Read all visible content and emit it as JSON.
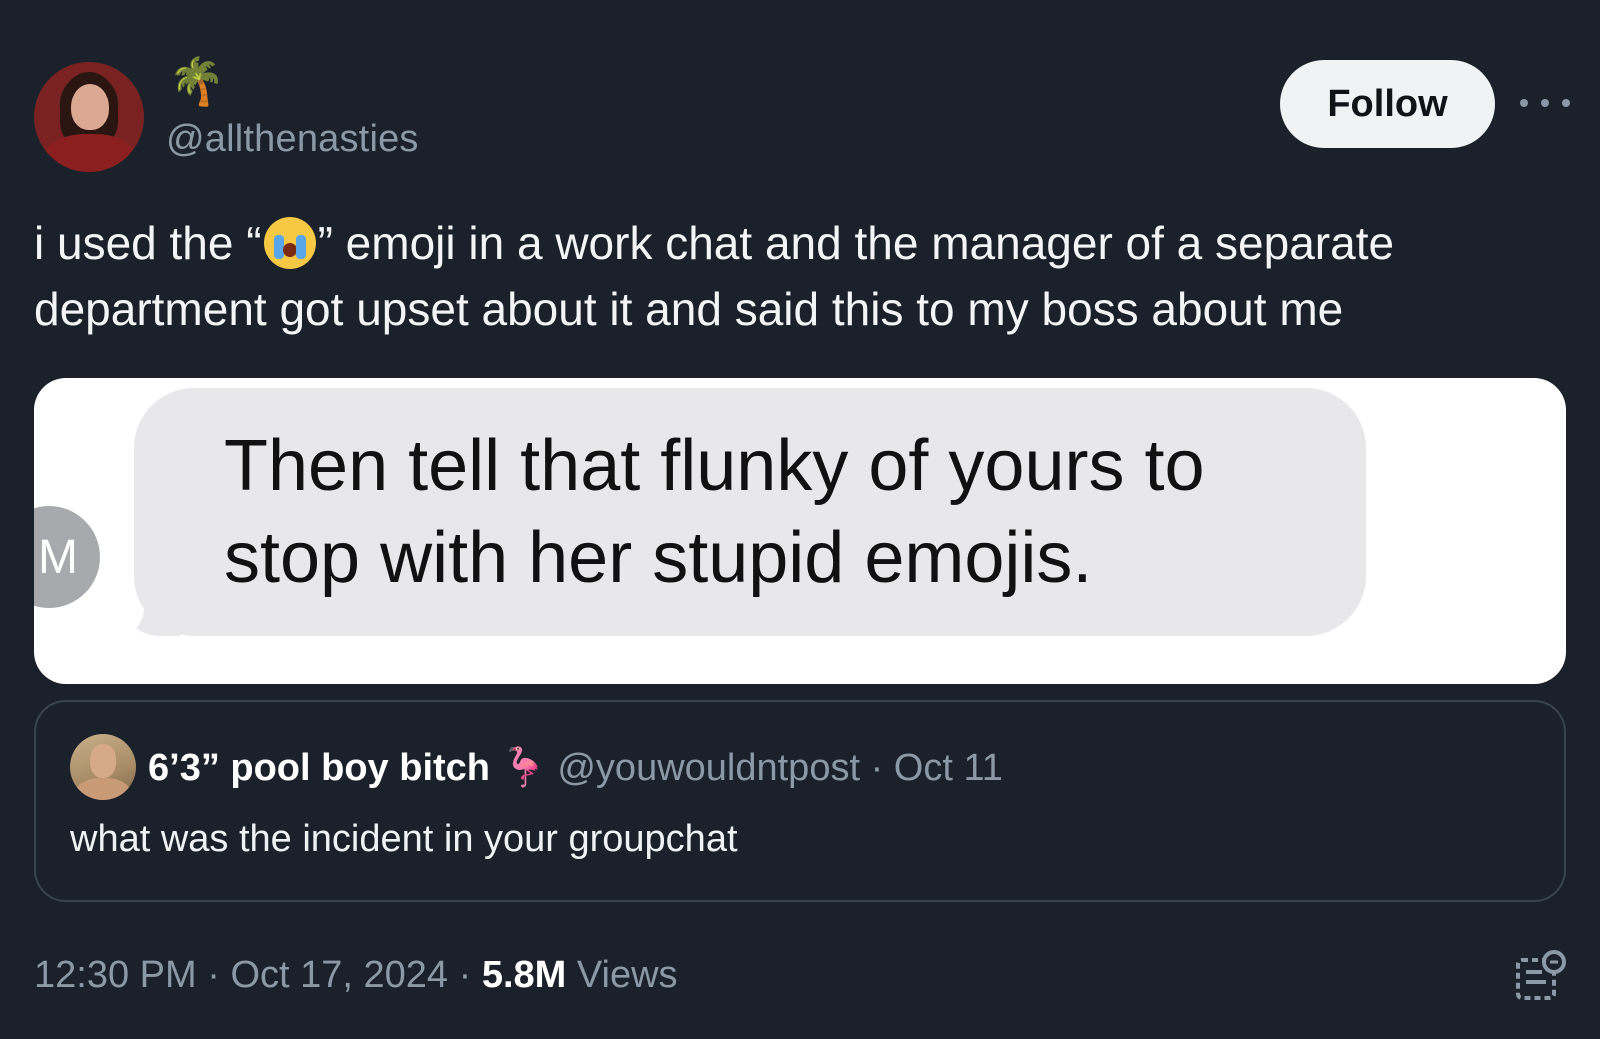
{
  "author": {
    "display_emoji": "🌴",
    "handle": "@allthenasties"
  },
  "header": {
    "follow_label": "Follow"
  },
  "tweet": {
    "text_before": "i used the “",
    "text_after": "” emoji in a work chat and the manager of a separate department got upset about it and said this to my boss about me",
    "inline_emoji": "loudly-crying-face"
  },
  "media": {
    "message_text": "Then tell that flunky of yours to stop with her stupid emojis.",
    "avatar_initial": "M"
  },
  "quoted": {
    "name": "6’3” pool boy bitch",
    "emoji": "🦩",
    "handle": "@youwouldntpost",
    "separator": " · ",
    "date": "Oct 11",
    "text": "what was the incident in your groupchat"
  },
  "footer": {
    "time": "12:30 PM",
    "sep1": " · ",
    "date": "Oct 17, 2024",
    "sep2": " · ",
    "views_count": "5.8M",
    "views_label": " Views"
  },
  "colors": {
    "background": "#1b212a",
    "secondary_text": "#8b98a5",
    "follow_button": "#eff3f4"
  }
}
